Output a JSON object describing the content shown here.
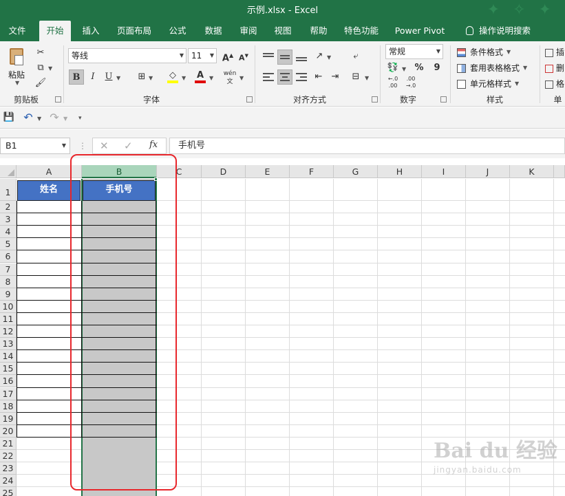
{
  "window": {
    "title": "示例.xlsx  -  Excel"
  },
  "tabs": [
    {
      "label": "文件"
    },
    {
      "label": "开始"
    },
    {
      "label": "插入"
    },
    {
      "label": "页面布局"
    },
    {
      "label": "公式"
    },
    {
      "label": "数据"
    },
    {
      "label": "审阅"
    },
    {
      "label": "视图"
    },
    {
      "label": "帮助"
    },
    {
      "label": "特色功能"
    },
    {
      "label": "Power Pivot"
    },
    {
      "label": "操作说明搜索"
    }
  ],
  "ribbon": {
    "clipboard": {
      "paste_label": "粘贴",
      "group": "剪贴板"
    },
    "font": {
      "family": "等线",
      "size": "11",
      "group": "字体",
      "bold": "B",
      "italic": "I",
      "underline": "U",
      "phonetic": "wén"
    },
    "alignment": {
      "group": "对齐方式"
    },
    "number": {
      "format": "常规",
      "percent": "%",
      "comma": "9",
      "dec_inc": "←.0\n.00",
      "dec_dec": ".00\n→.0",
      "group": "数字"
    },
    "styles": {
      "conditional": "条件格式",
      "table": "套用表格格式",
      "cell": "单元格样式",
      "group": "样式"
    },
    "cells": {
      "insert": "插",
      "delete": "删",
      "format": "格",
      "group": "单"
    }
  },
  "formula_bar": {
    "name_box": "B1",
    "fx": "fx",
    "content": "手机号"
  },
  "columns": [
    "A",
    "B",
    "C",
    "D",
    "E",
    "F",
    "G",
    "H",
    "I",
    "J",
    "K"
  ],
  "rows": [
    "1",
    "2",
    "3",
    "4",
    "5",
    "6",
    "7",
    "8",
    "9",
    "10",
    "11",
    "12",
    "13",
    "14",
    "15",
    "16",
    "17",
    "18",
    "19",
    "20",
    "21",
    "22",
    "23",
    "24",
    "25"
  ],
  "cells": {
    "A1": "姓名",
    "B1": "手机号"
  },
  "selection": {
    "range": "B",
    "color": "#217346",
    "highlight": "#e8262b"
  },
  "watermark": {
    "brand": "Bai du 经验",
    "url": "jingyan.baidu.com"
  }
}
